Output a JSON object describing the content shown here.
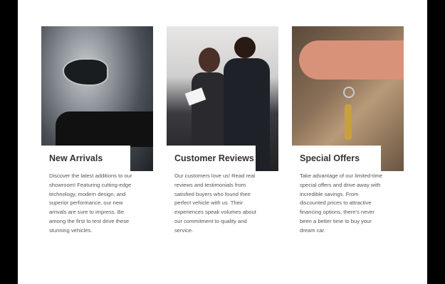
{
  "cards": [
    {
      "title": "New Arrivals",
      "image": "car-headlight-photo",
      "description": "Discover the latest additions to our showroom! Featuring cutting-edge technology, modern design, and superior performance, our new arrivals are sure to impress. Be among the first to test drive these stunning vehicles."
    },
    {
      "title": "Customer Reviews",
      "image": "couple-reviewing-documents-photo",
      "description": "Our customers love us! Read real reviews and testimonials from satisfied buyers who found their perfect vehicle with us. Their experiences speak volumes about our commitment to quality and service."
    },
    {
      "title": "Special Offers",
      "image": "hand-holding-car-keys-photo",
      "description": "Take advantage of our limited-time special offers and drive away with incredible savings. From discounted prices to attractive financing options, there's never been a better time to buy your dream car."
    }
  ]
}
